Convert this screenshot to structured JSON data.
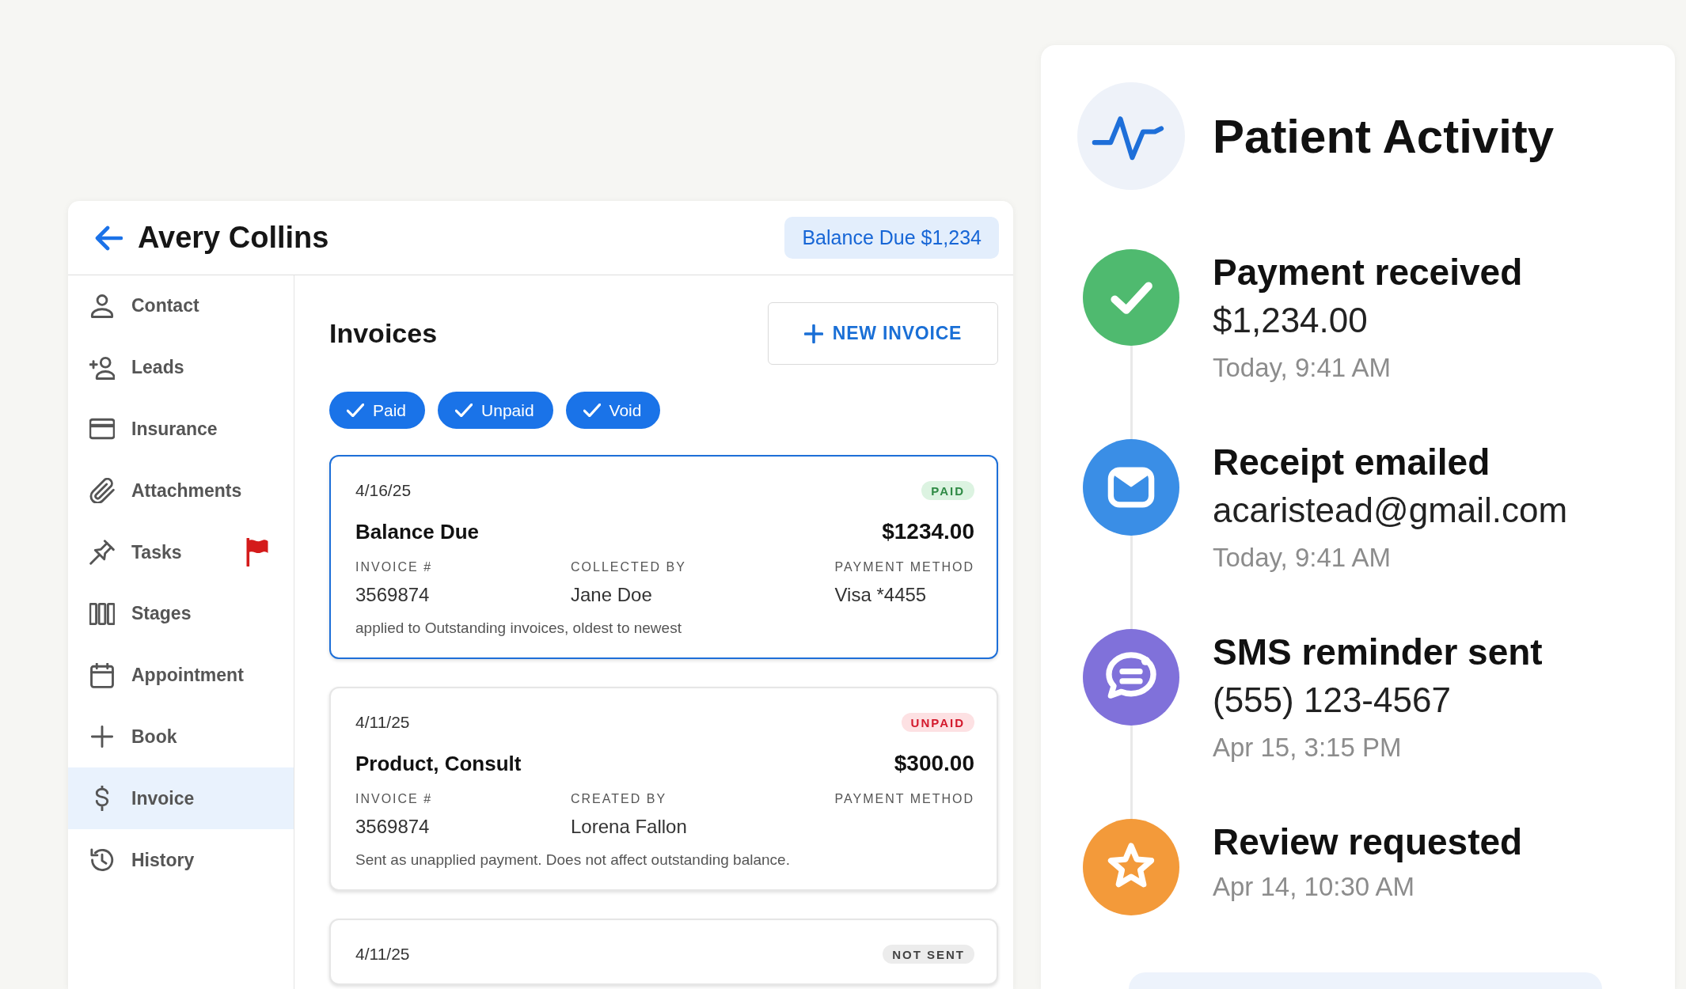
{
  "header": {
    "title": "Avery Collins",
    "balance": "Balance Due $1,234"
  },
  "sidebar": {
    "items": [
      {
        "kind": "contact",
        "label": "Contact",
        "selected": false,
        "flagged": false
      },
      {
        "kind": "leads",
        "label": "Leads",
        "selected": false,
        "flagged": false
      },
      {
        "kind": "insurance",
        "label": "Insurance",
        "selected": false,
        "flagged": false
      },
      {
        "kind": "attachments",
        "label": "Attachments",
        "selected": false,
        "flagged": false
      },
      {
        "kind": "tasks",
        "label": "Tasks",
        "selected": false,
        "flagged": true
      },
      {
        "kind": "stages",
        "label": "Stages",
        "selected": false,
        "flagged": false
      },
      {
        "kind": "appointment",
        "label": "Appointment",
        "selected": false,
        "flagged": false
      },
      {
        "kind": "book",
        "label": "Book",
        "selected": false,
        "flagged": false
      },
      {
        "kind": "invoice",
        "label": "Invoice",
        "selected": true,
        "flagged": false
      },
      {
        "kind": "history",
        "label": "History",
        "selected": false,
        "flagged": false
      }
    ]
  },
  "main": {
    "title": "Invoices",
    "new_button": "NEW INVOICE",
    "filters": [
      {
        "label": "Paid",
        "checked": true
      },
      {
        "label": "Unpaid",
        "checked": true
      },
      {
        "label": "Void",
        "checked": true
      }
    ],
    "invoices": [
      {
        "date": "4/16/25",
        "status": {
          "kind": "paid",
          "label": "PAID"
        },
        "selected": true,
        "title": "Balance Due",
        "amount": "$1234.00",
        "fields": [
          {
            "label": "INVOICE #",
            "value": "3569874"
          },
          {
            "label": "COLLECTED BY",
            "value": "Jane Doe"
          },
          {
            "label": "PAYMENT METHOD",
            "value": "Visa *4455"
          }
        ],
        "note": "applied to Outstanding invoices, oldest to newest"
      },
      {
        "date": "4/11/25",
        "status": {
          "kind": "unpaid",
          "label": "UNPAID"
        },
        "selected": false,
        "title": "Product, Consult",
        "amount": "$300.00",
        "fields": [
          {
            "label": "INVOICE #",
            "value": "3569874"
          },
          {
            "label": "CREATED BY",
            "value": "Lorena Fallon"
          },
          {
            "label": "PAYMENT METHOD"
          }
        ],
        "note": "Sent as unapplied payment. Does not affect outstanding balance."
      },
      {
        "date": "4/11/25",
        "status": {
          "kind": "not_sent",
          "label": "NOT SENT"
        },
        "selected": false
      }
    ]
  },
  "activity": {
    "title": "Patient Activity",
    "items": [
      {
        "kind": "payment",
        "color": "#4fba6f",
        "title": "Payment received",
        "detail": "$1,234.00",
        "time": "Today, 9:41 AM"
      },
      {
        "kind": "email",
        "color": "#3a8ee6",
        "title": "Receipt emailed",
        "detail": "acaristead@gmail.com",
        "time": "Today, 9:41 AM"
      },
      {
        "kind": "sms",
        "color": "#8071da",
        "title": "SMS reminder sent",
        "detail": "(555) 123-4567",
        "time": "Apr 15, 3:15 PM"
      },
      {
        "kind": "review",
        "color": "#f39a3a",
        "title": "Review requested",
        "time": "Apr 14, 10:30 AM"
      }
    ]
  }
}
